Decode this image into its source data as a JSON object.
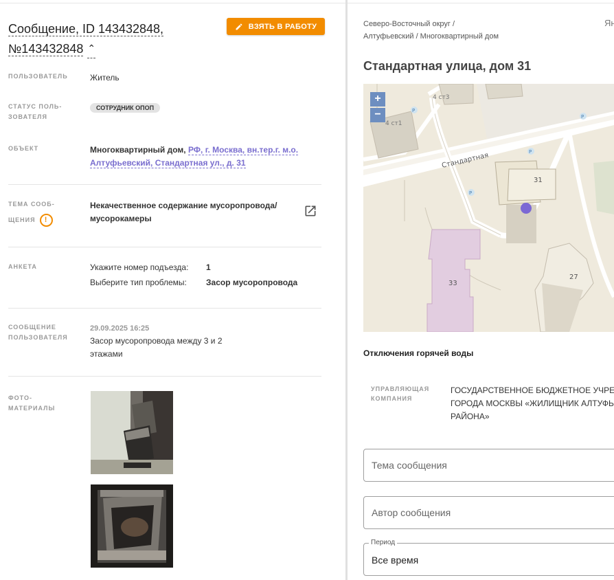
{
  "header": {
    "title_line1": "Сообщение, ID 143432848,",
    "title_line2": "№143432848",
    "take_button": "ВЗЯТЬ В РАБОТУ"
  },
  "details": {
    "user_label": "ПОЛЬЗОВАТЕЛЬ",
    "user_value": "Житель",
    "status_label_1": "СТАТУС ПОЛЬ-",
    "status_label_2": "ЗОВАТЕЛЯ",
    "status_value": "СОТРУДНИК ОПОП",
    "object_label": "ОБЪЕКТ",
    "object_type": "Многоквартирный дом,",
    "object_addr_1": "РФ, г. Москва, вн.тер.г. м.о.",
    "object_addr_2": "Алтуфьевский, Стандартная ул., д. 31",
    "topic_label_1": "ТЕМА СООБ-",
    "topic_label_2": "ЩЕНИЯ",
    "topic_value_1": "Некачественное содержание мусоропровода/",
    "topic_value_2": "мусорокамеры",
    "survey_label": "АНКЕТА",
    "survey_q1": "Укажите номер подъезда:",
    "survey_a1": "1",
    "survey_q2": "Выберите тип проблемы:",
    "survey_a2": "Засор мусоропровода",
    "msg_label_1": "СООБЩЕНИЕ",
    "msg_label_2": "ПОЛЬЗОВАТЕЛЯ",
    "msg_date": "29.09.2025 16:25",
    "msg_text_1": "Засор мусоропровода между 3 и 2",
    "msg_text_2": "этажами",
    "photo_label_1": "ФОТО-",
    "photo_label_2": "МАТЕРИАЛЫ"
  },
  "right": {
    "crumb_1": "Северо-Восточный округ /",
    "crumb_2": "Алтуфьевский / Многоквартирный дом",
    "yan": "Ян",
    "address": "Стандартная улица, дом 31",
    "map": {
      "zoom_in": "+",
      "zoom_out": "−",
      "street": "Стандартная",
      "b31": "31",
      "b33": "33",
      "b27": "27",
      "b4st3": "4 ст3",
      "b4st1": "4 ст1",
      "parking": "P"
    },
    "outage": "Отключения горячей воды",
    "mgmt_label_1": "УПРАВЛЯЮЩАЯ",
    "mgmt_label_2": "КОМПАНИЯ",
    "mgmt_1": "ГОСУДАРСТВЕННОЕ БЮДЖЕТНОЕ УЧРЕЖ",
    "mgmt_2": "ГОРОДА МОСКВЫ «ЖИЛИЩНИК АЛТУФЬ",
    "mgmt_3": "РАЙОНА»",
    "topic_placeholder": "Тема сообщения",
    "author_placeholder": "Автор сообщения",
    "period_label": "Период",
    "period_value": "Все время"
  }
}
